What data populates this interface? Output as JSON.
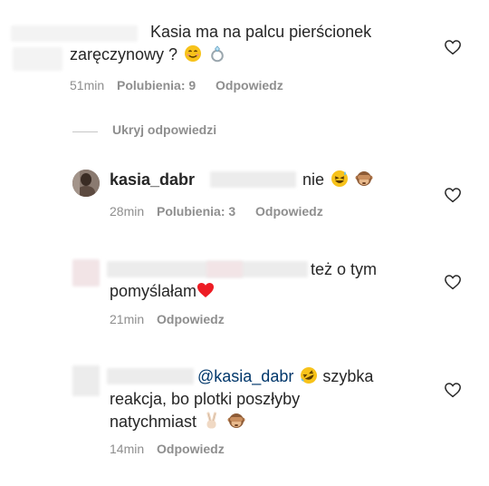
{
  "comments": [
    {
      "text_line1": "Kasia ma na palcu pierścionek",
      "text_line2": "zaręczynowy ? ",
      "time": "51min",
      "likes": "Polubienia: 9",
      "reply": "Odpowiedz"
    }
  ],
  "toggle_replies": "Ukryj odpowiedzi",
  "replies": [
    {
      "username": "kasia_dabr",
      "text": "nie",
      "time": "28min",
      "likes": "Polubienia: 3",
      "reply": "Odpowiedz"
    },
    {
      "text_line1": "też o tym",
      "text_line2": "pomyślałam",
      "time": "21min",
      "reply": "Odpowiedz"
    },
    {
      "mention": "@kasia_dabr",
      "text_line1": " szybka",
      "text_line2": "reakcja, bo plotki poszłyby",
      "text_line3": "natychmiast",
      "time": "14min",
      "reply": "Odpowiedz"
    }
  ],
  "icons": {
    "like": "heart-outline-icon",
    "emojis": [
      "smiling-face-icon",
      "ring-icon",
      "sweat-smile-icon",
      "see-no-evil-monkey-icon",
      "red-heart-icon",
      "rolling-laughing-icon",
      "victory-hand-icon"
    ]
  },
  "colors": {
    "meta_text": "#8e8e8e",
    "main_text": "#262626",
    "mention": "#00376b",
    "heart_red": "#ed1c24"
  }
}
